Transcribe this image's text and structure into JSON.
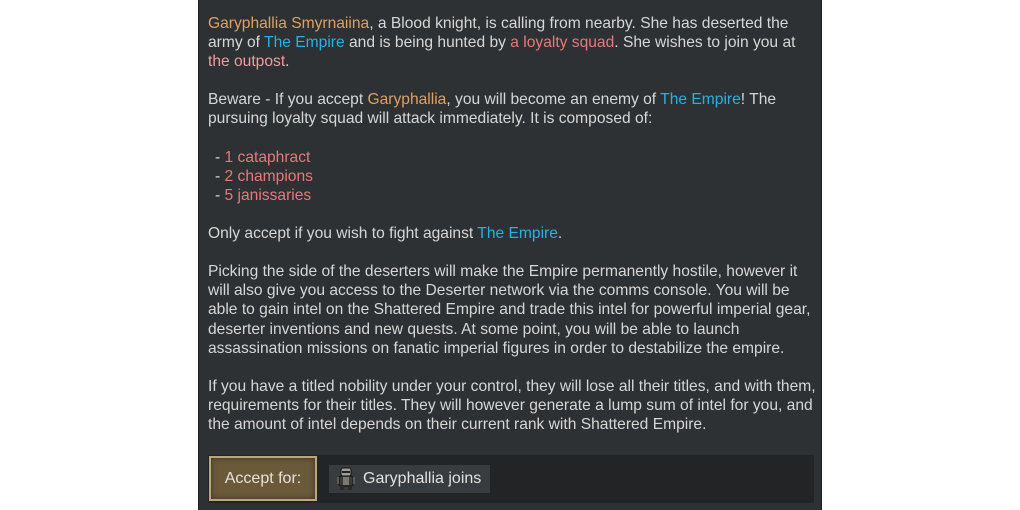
{
  "letter": {
    "p1": {
      "name": "Garyphallia Smyrnaiina",
      "t1": ", a Blood knight, is calling from nearby. She has deserted the army of ",
      "faction": "The Empire",
      "t2": " and is being hunted by ",
      "hunters": "a loyalty squad",
      "t3": ". She wishes to join you at ",
      "place": "the outpost",
      "t4": "."
    },
    "p2": {
      "t1": "Beware - If you accept ",
      "name": "Garyphallia",
      "t2": ", you will become an enemy of ",
      "faction": "The Empire",
      "t3": "! The pursuing loyalty squad will attack immediately. It is composed of:"
    },
    "units": [
      {
        "dash": "- ",
        "label": "1 cataphract"
      },
      {
        "dash": "- ",
        "label": "2 champions"
      },
      {
        "dash": "- ",
        "label": "5 janissaries"
      }
    ],
    "p3": {
      "t1": "Only accept if you wish to fight against ",
      "faction": "The Empire",
      "t2": "."
    },
    "p4": "Picking the side of the deserters will make the Empire permanently hostile, however it will also give you access to the Deserter network via the comms console. You will be able to gain intel on the Shattered Empire and trade this intel for powerful imperial gear, deserter inventions and new quests. At some point, you will be able to launch assassination missions on fanatic imperial figures in order to destabilize the empire.",
    "p5": "If you have a titled nobility under your control, they will lose all their titles, and with them, requirements for their titles. They will however generate a lump sum of intel for you, and the amount of intel depends on their current rank with Shattered Empire."
  },
  "options": {
    "accept_label": "Accept for:",
    "reward_label": "Garyphallia joins",
    "reward_icon": "pawn-portrait-icon"
  },
  "colors": {
    "background": "#2e3133",
    "name": "#e0a060",
    "faction": "#24b2e6",
    "hostile": "#e8787a",
    "place": "#f49aa0",
    "accept_button": "#6a5a3a"
  }
}
